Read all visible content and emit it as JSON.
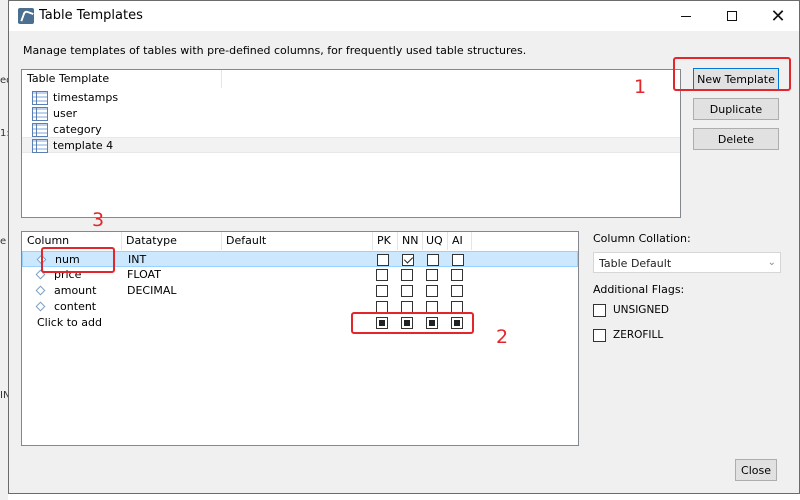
{
  "window": {
    "title": "Table Templates",
    "description": "Manage templates of tables with pre-defined columns, for frequently used table structures."
  },
  "background_fragments": [
    "ed",
    "1:",
    "e",
    "IN"
  ],
  "templates": {
    "header": "Table Template",
    "items": [
      {
        "label": "timestamps",
        "selected": false
      },
      {
        "label": "user",
        "selected": false
      },
      {
        "label": "category",
        "selected": false
      },
      {
        "label": "template 4",
        "selected": true
      }
    ]
  },
  "buttons": {
    "new_template": "New Template",
    "duplicate": "Duplicate",
    "delete": "Delete",
    "close": "Close"
  },
  "columns": {
    "headers": {
      "column": "Column",
      "datatype": "Datatype",
      "default": "Default",
      "pk": "PK",
      "nn": "NN",
      "uq": "UQ",
      "ai": "AI"
    },
    "rows": [
      {
        "name": "num",
        "datatype": "INT",
        "default": "",
        "pk": false,
        "nn": true,
        "uq": false,
        "ai": false,
        "selected": true
      },
      {
        "name": "price",
        "datatype": "FLOAT",
        "default": "",
        "pk": false,
        "nn": false,
        "uq": false,
        "ai": false,
        "selected": false
      },
      {
        "name": "amount",
        "datatype": "DECIMAL",
        "default": "",
        "pk": false,
        "nn": false,
        "uq": false,
        "ai": false,
        "selected": false
      },
      {
        "name": "content",
        "datatype": "",
        "default": "",
        "pk": false,
        "nn": false,
        "uq": false,
        "ai": false,
        "selected": false
      }
    ],
    "add_row_label": "Click to add"
  },
  "side": {
    "collation_label": "Column Collation:",
    "collation_value": "Table Default",
    "flags_label": "Additional Flags:",
    "flags": [
      {
        "label": "UNSIGNED",
        "checked": false
      },
      {
        "label": "ZEROFILL",
        "checked": false
      }
    ]
  },
  "annotations": [
    "1",
    "2",
    "3"
  ],
  "colors": {
    "accent": "#0078d7",
    "annotation": "#e3262b",
    "selection": "#cce8ff"
  }
}
